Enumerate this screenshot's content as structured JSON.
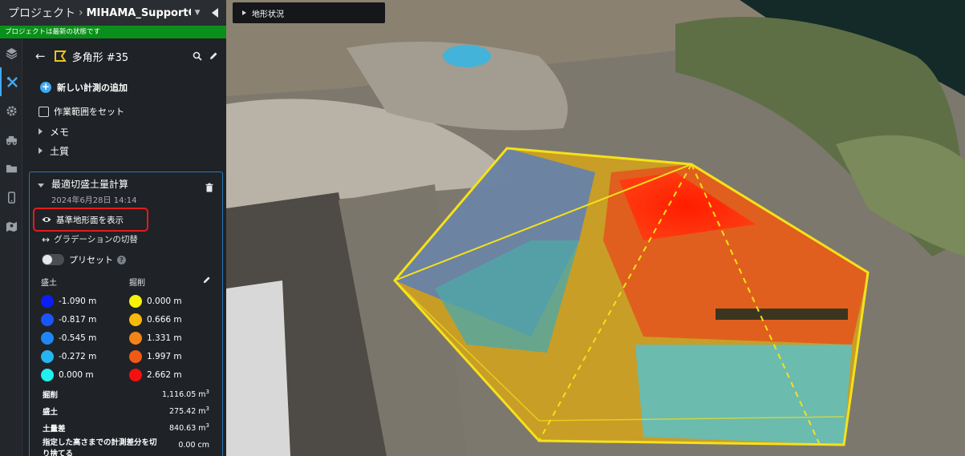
{
  "header": {
    "root": "プロジェクト",
    "separator": "›",
    "project": "MIHAMA_SupportCe..."
  },
  "status": "プロジェクトは最新の状態です",
  "panel": {
    "title": "多角形 #35",
    "add_measurement": "新しい計測の追加",
    "work_area": "作業範囲をセット",
    "memo": "メモ",
    "soil": "土質"
  },
  "card": {
    "title": "最適切盛土量計算",
    "date": "2024年6月28日 14:14",
    "show_reference": "基準地形面を表示",
    "toggle_gradation": "グラデーションの切替",
    "preset": "プリセット",
    "help": "?",
    "fill_header": "盛土",
    "cut_header": "掘削",
    "fill_legend": [
      {
        "value": "-1.090 m",
        "color": "#0a1ef5"
      },
      {
        "value": "-0.817 m",
        "color": "#1a56f5"
      },
      {
        "value": "-0.545 m",
        "color": "#1f87f5"
      },
      {
        "value": "-0.272 m",
        "color": "#25b5f2"
      },
      {
        "value": "0.000 m",
        "color": "#1ff0f0"
      }
    ],
    "cut_legend": [
      {
        "value": "0.000 m",
        "color": "#f8f20a"
      },
      {
        "value": "0.666 m",
        "color": "#f6b80c"
      },
      {
        "value": "1.331 m",
        "color": "#f48418"
      },
      {
        "value": "1.997 m",
        "color": "#f25a14"
      },
      {
        "value": "2.662 m",
        "color": "#f21010"
      }
    ],
    "stats": [
      {
        "label": "掘削",
        "value": "1,116.05 m",
        "unit": "3"
      },
      {
        "label": "盛土",
        "value": "275.42 m",
        "unit": "3"
      },
      {
        "label": "土量差",
        "value": "840.63 m",
        "unit": "3"
      }
    ],
    "truncate_label": "指定した高さまでの計測差分を切り捨てる",
    "truncate_value": "0.00 cm"
  },
  "viewport": {
    "terrain_tab": "地形状況"
  },
  "colors": {
    "accent": "#3fa9f5",
    "status_green": "#0a8f1a",
    "highlight_red": "#e51b1b"
  }
}
